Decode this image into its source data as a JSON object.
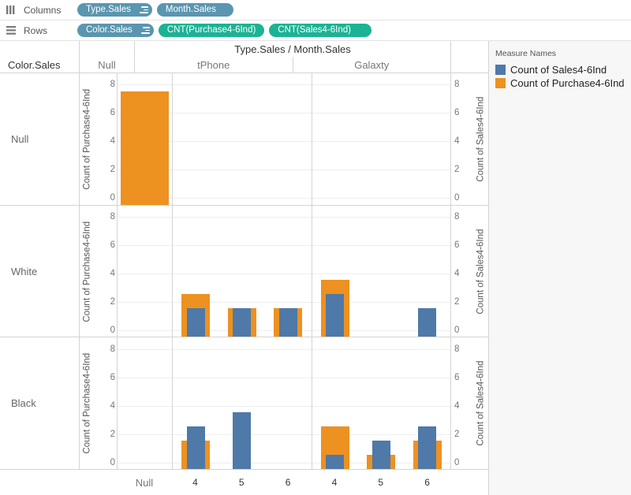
{
  "shelves": {
    "columns": {
      "label": "Columns",
      "icon": "columns-icon",
      "pills": [
        {
          "text": "Type.Sales",
          "kind": "dimension",
          "hierarchy": true
        },
        {
          "text": "Month.Sales",
          "kind": "dimension",
          "hierarchy": false
        }
      ]
    },
    "rows": {
      "label": "Rows",
      "icon": "rows-icon",
      "pills": [
        {
          "text": "Color.Sales",
          "kind": "dimension",
          "hierarchy": true
        },
        {
          "text": "CNT(Purchase4-6Ind)",
          "kind": "measure",
          "hierarchy": false
        },
        {
          "text": "CNT(Sales4-6Ind)",
          "kind": "measure",
          "hierarchy": false
        }
      ]
    }
  },
  "headers": {
    "column_field_title": "Type.Sales / Month.Sales",
    "row_field_title": "Color.Sales",
    "column_groups": [
      "Null",
      "tPhone",
      "Galaxty"
    ],
    "bottom_ticks": {
      "null": "Null",
      "tphone": [
        "4",
        "5",
        "6"
      ],
      "galaxty": [
        "4",
        "5",
        "6"
      ]
    }
  },
  "legend": {
    "title": "Measure Names",
    "items": [
      {
        "label": "Count of Sales4-6Ind",
        "color": "#4e79a8"
      },
      {
        "label": "Count of Purchase4-6Ind",
        "color": "#ed9121"
      }
    ]
  },
  "colors": {
    "blue": "#4e79a8",
    "orange": "#ed9121",
    "dimension_pill": "#5a96b0",
    "measure_pill": "#1bb394",
    "gridline": "#edeef0",
    "border": "#d4d4d4"
  },
  "chart_data": {
    "type": "bar",
    "title": "Type.Sales / Month.Sales",
    "xlabel": "",
    "ylabel_left": "Count of Purchase4-6Ind",
    "ylabel_right": "Count of Sales4-6Ind",
    "ylim": [
      0,
      8
    ],
    "yticks": [
      0,
      2,
      4,
      6,
      8
    ],
    "grid": true,
    "legend_position": "right",
    "row_field": "Color.Sales",
    "rows": [
      "Null",
      "White",
      "Black"
    ],
    "column_field": "Type.Sales / Month.Sales",
    "column_groups": [
      "Null",
      "tPhone",
      "Galaxty"
    ],
    "categories": [
      "Null",
      "tPhone-4",
      "tPhone-5",
      "tPhone-6",
      "Galaxty-4",
      "Galaxty-5",
      "Galaxty-6"
    ],
    "series": [
      {
        "name": "Count of Purchase4-6Ind",
        "color": "#ed9121",
        "values_by_row": {
          "Null": [
            8,
            0,
            0,
            0,
            0,
            0,
            0
          ],
          "White": [
            0,
            3,
            2,
            2,
            4,
            0,
            0
          ],
          "Black": [
            0,
            2,
            0,
            0,
            3,
            1,
            2
          ]
        }
      },
      {
        "name": "Count of Sales4-6Ind",
        "color": "#4e79a8",
        "values_by_row": {
          "Null": [
            0,
            0,
            0,
            0,
            0,
            0,
            0
          ],
          "White": [
            0,
            2,
            2,
            2,
            3,
            0,
            2
          ],
          "Black": [
            0,
            3,
            4,
            0,
            1,
            2,
            3
          ]
        }
      }
    ]
  }
}
